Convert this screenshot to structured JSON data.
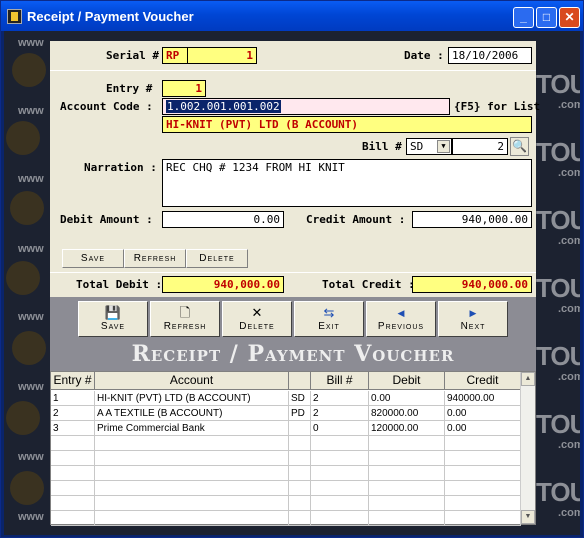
{
  "window": {
    "title": "Receipt / Payment Voucher"
  },
  "watermark": {
    "left": "www",
    "right": "TOUC",
    "right_sub": ".com"
  },
  "form": {
    "serial_label": "Serial #",
    "serial_prefix": "RP",
    "serial_value": "1",
    "date_label": "Date :",
    "date_value": "18/10/2006",
    "entry_label": "Entry #",
    "entry_value": "1",
    "account_code_label": "Account Code :",
    "account_code_value": "1.002.001.001.002",
    "f5_hint": "{F5} for List",
    "account_name": "HI-KNIT (PVT) LTD (B ACCOUNT)",
    "bill_label": "Bill #",
    "bill_type": "SD",
    "bill_number": "2",
    "narration_label": "Narration :",
    "narration_value": "REC CHQ # 1234 FROM HI KNIT",
    "debit_label": "Debit Amount :",
    "debit_value": "0.00",
    "credit_label": "Credit Amount :",
    "credit_value": "940,000.00",
    "total_debit_label": "Total Debit :",
    "total_debit_value": "940,000.00",
    "total_credit_label": "Total Credit :",
    "total_credit_value": "940,000.00"
  },
  "small_buttons": {
    "save": "Save",
    "refresh": "Refresh",
    "delete": "Delete"
  },
  "toolbar": {
    "save": "Save",
    "refresh": "Refresh",
    "delete": "Delete",
    "exit": "Exit",
    "previous": "Previous",
    "next": "Next"
  },
  "banner": "Receipt / Payment Voucher",
  "grid": {
    "headers": [
      "Entry #",
      "Account",
      "",
      "Bill #",
      "Debit",
      "Credit"
    ],
    "rows": [
      [
        "1",
        "HI-KNIT (PVT) LTD (B ACCOUNT)",
        "SD",
        "2",
        "0.00",
        "940000.00"
      ],
      [
        "2",
        "A A TEXTILE (B ACCOUNT)",
        "PD",
        "2",
        "820000.00",
        "0.00"
      ],
      [
        "3",
        "Prime Commercial Bank",
        "",
        "0",
        "120000.00",
        "0.00"
      ]
    ]
  },
  "colors": {
    "title_bar": "#0046d5",
    "highlight": "#ffff80",
    "amount_text": "#c00000",
    "selection": "#0a246a"
  }
}
